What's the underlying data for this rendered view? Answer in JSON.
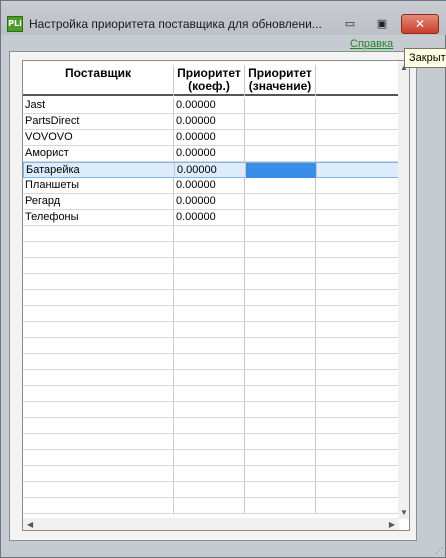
{
  "window": {
    "icon_text": "PLi",
    "title": "Настройка приоритета поставщика для обновлени...",
    "minimize_label": "▭",
    "maximize_label": "▣",
    "close_label": "✕"
  },
  "help_link": "Справка",
  "tooltip": "Закрыть",
  "table": {
    "headers": [
      "Поставщик",
      "Приоритет (коеф.)",
      "Приоритет (значение)",
      ""
    ],
    "rows": [
      {
        "name": "Jast",
        "coef": "0.00000",
        "value": ""
      },
      {
        "name": "PartsDirect",
        "coef": "0.00000",
        "value": ""
      },
      {
        "name": "VOVOVO",
        "coef": "0.00000",
        "value": ""
      },
      {
        "name": "Аморист",
        "coef": "0.00000",
        "value": ""
      },
      {
        "name": "Батарейка",
        "coef": "0.00000",
        "value": ""
      },
      {
        "name": "Планшеты",
        "coef": "0.00000",
        "value": ""
      },
      {
        "name": "Регард",
        "coef": "0.00000",
        "value": ""
      },
      {
        "name": "Телефоны",
        "coef": "0.00000",
        "value": ""
      }
    ],
    "selected_row": 4
  },
  "scroll": {
    "up_arrow": "▲",
    "down_arrow": "▼",
    "left_arrow": "◀",
    "right_arrow": "▶"
  }
}
